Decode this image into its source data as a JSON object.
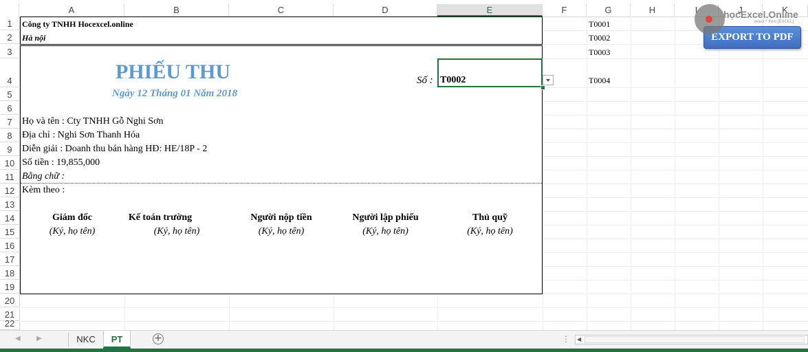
{
  "columns": [
    "A",
    "B",
    "C",
    "D",
    "E",
    "F",
    "G",
    "H",
    "I",
    "J",
    "K"
  ],
  "selected_column": "E",
  "rows": [
    "1",
    "2",
    "3",
    "4",
    "5",
    "6",
    "7",
    "8",
    "9",
    "10",
    "11",
    "12",
    "13",
    "14",
    "15",
    "16",
    "17",
    "18",
    "19",
    "20",
    "21",
    "22"
  ],
  "company": {
    "name": "Công ty TNHH Hocexcel.online",
    "city": "Hà nội"
  },
  "receipt": {
    "title": "PHIẾU THU",
    "date": "Ngày  12 Tháng 01 Năm 2018",
    "number_label": "Số :",
    "number_value": "T0002",
    "payer": "Họ và tên : Cty TNHH Gỗ Nghi Sơn",
    "address": "Địa chỉ : Nghi Sơn Thanh Hóa",
    "description": "Diễn giải : Doanh thu bán hàng HĐ:  HE/18P - 2",
    "amount": "Số tiền : 19,855,000",
    "in_words": "Bằng chữ :",
    "attached": "Kèm theo :"
  },
  "signatures": [
    {
      "title": "Giám đốc",
      "sub": "(Ký, họ tên)"
    },
    {
      "title": "Kế toán trường",
      "sub": "(Ký, họ tên)"
    },
    {
      "title": "Người nộp tiền",
      "sub": "(Ký, họ tên)"
    },
    {
      "title": "Người lập phiếu",
      "sub": "(Ký, họ tên)"
    },
    {
      "title": "Thủ quỹ",
      "sub": "(Ký, họ tên)"
    }
  ],
  "dropdown_list": [
    "T0001",
    "T0002",
    "T0003",
    "T0004"
  ],
  "export_button": "EXPORT TO PDF",
  "watermark": {
    "brand": "họcExcel.Online",
    "tagline": "select * from [EXCEL]"
  },
  "sheet_tabs": [
    {
      "label": "NKC",
      "active": false
    },
    {
      "label": "PT",
      "active": true
    }
  ],
  "colors": {
    "excel_green": "#217346",
    "title_blue": "#5b9bd5",
    "button_blue": "#4472c4"
  }
}
